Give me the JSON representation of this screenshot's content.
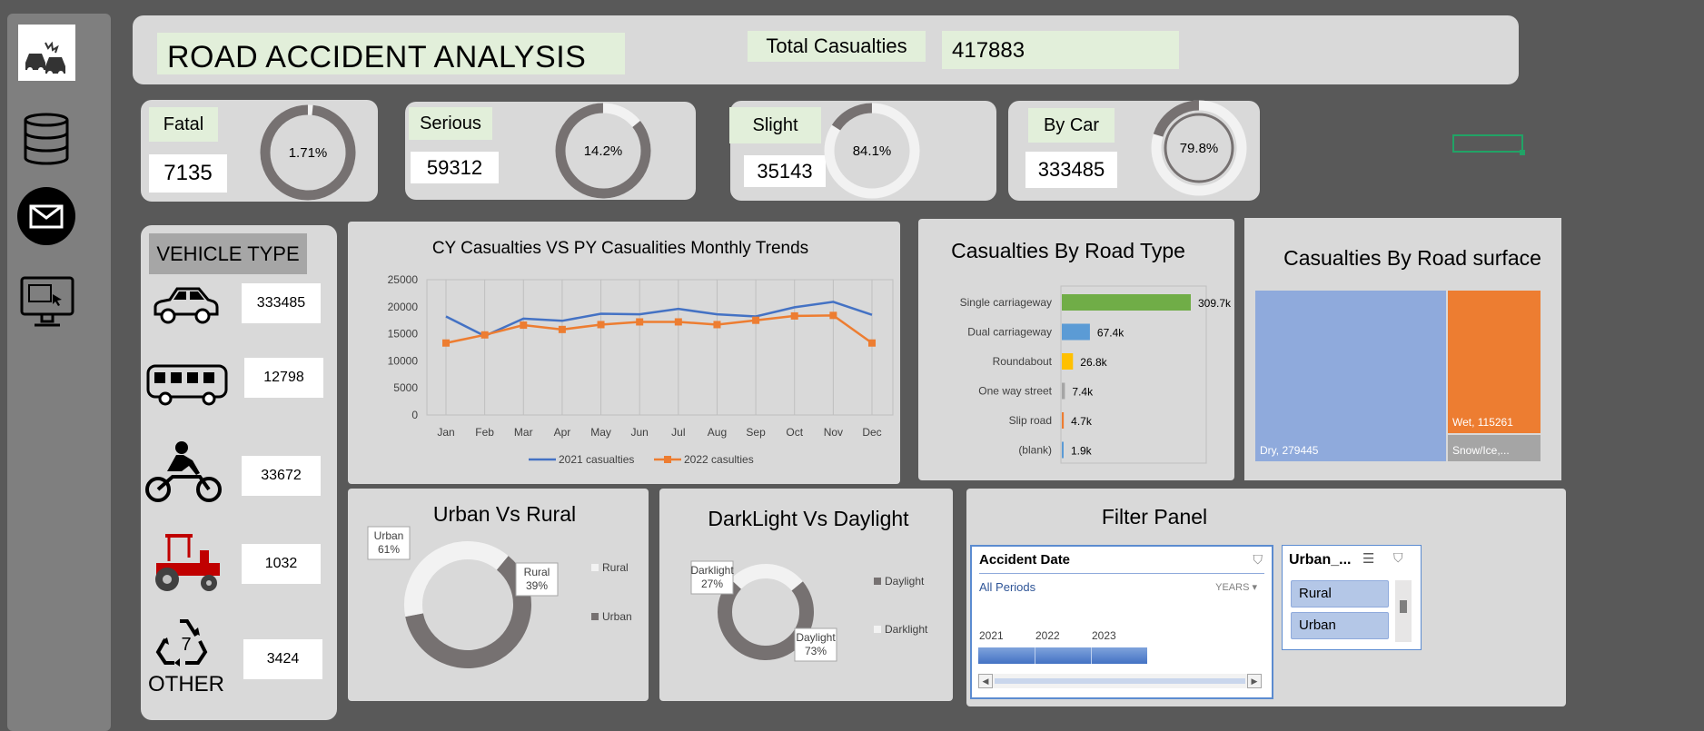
{
  "header": {
    "title": "ROAD ACCIDENT ANALYSIS",
    "total_label": "Total Casualties",
    "total_value": "417883"
  },
  "kpis": [
    {
      "label": "Fatal",
      "value": "7135",
      "pct_label": "1.71%",
      "pct": 1.71
    },
    {
      "label": "Serious",
      "value": "59312",
      "pct_label": "14.2%",
      "pct": 14.2
    },
    {
      "label": "Slight",
      "value": "35143",
      "pct_label": "84.1%",
      "pct": 84.1
    },
    {
      "label": "By Car",
      "value": "333485",
      "pct_label": "79.8%",
      "pct": 79.8
    }
  ],
  "vehicle": {
    "title": "VEHICLE TYPE",
    "items": [
      {
        "icon": "car-icon",
        "value": "333485"
      },
      {
        "icon": "bus-icon",
        "value": "12798"
      },
      {
        "icon": "motorbike-icon",
        "value": "33672"
      },
      {
        "icon": "tractor-icon",
        "value": "1032"
      },
      {
        "icon": "recycle-icon",
        "value": "3424",
        "label": "OTHER"
      }
    ]
  },
  "sidebar": {
    "icons": [
      "car-crash-icon",
      "database-icon",
      "mail-icon",
      "monitor-icon"
    ]
  },
  "colors": {
    "page_bg": "#595959",
    "panel": "#d9d9d9",
    "label_green": "#e2efda",
    "series_2021": "#4472c4",
    "series_2022": "#ed7d31",
    "donut_dark": "#767171",
    "donut_light": "#f2f2f2"
  },
  "chart_data": [
    {
      "type": "line",
      "title": "CY Casualties VS PY Casualities Monthly Trends",
      "categories": [
        "Jan",
        "Feb",
        "Mar",
        "Apr",
        "May",
        "Jun",
        "Jul",
        "Aug",
        "Sep",
        "Oct",
        "Nov",
        "Dec"
      ],
      "series": [
        {
          "name": "2021 casualties",
          "values": [
            18200,
            14600,
            17800,
            17400,
            18700,
            18600,
            19600,
            18600,
            18200,
            19900,
            20900,
            18500
          ]
        },
        {
          "name": "2022 casulties",
          "values": [
            13300,
            14800,
            16600,
            15800,
            16700,
            17200,
            17200,
            16700,
            17500,
            18300,
            18400,
            13300
          ]
        }
      ],
      "y_ticks": [
        "25000",
        "20000",
        "15000",
        "10000",
        "5000",
        "0"
      ],
      "ylim": [
        0,
        25000
      ],
      "grid": true,
      "legend": "bottom"
    },
    {
      "type": "bar",
      "title": "Casualties By Road Type",
      "categories": [
        "Single carriageway",
        "Dual carriageway",
        "Roundabout",
        "One way street",
        "Slip road",
        "(blank)"
      ],
      "values": [
        309.7,
        67.4,
        26.8,
        7.4,
        4.7,
        1.9
      ],
      "labels": [
        "309.7k",
        "67.4k",
        "26.8k",
        "7.4k",
        "4.7k",
        "1.9k"
      ],
      "colors": [
        "#70ad47",
        "#5b9bd5",
        "#ffc000",
        "#a5a5a5",
        "#ed7d31",
        "#5b9bd5"
      ],
      "orientation": "horizontal"
    },
    {
      "type": "treemap",
      "title": "Casualties By Road surface",
      "items": [
        {
          "label": "Dry, 279445",
          "value": 279445,
          "color": "#8faadc"
        },
        {
          "label": "Wet, 115261",
          "value": 115261,
          "color": "#ed7d31"
        },
        {
          "label": "Snow/Ice,...",
          "value": 23177,
          "color": "#a5a5a5"
        }
      ]
    },
    {
      "type": "pie",
      "title": "Urban Vs Rural",
      "slices": [
        {
          "name": "Urban",
          "label": "Urban\n61%",
          "value": 61,
          "color": "#767171"
        },
        {
          "name": "Rural",
          "label": "Rural\n39%",
          "value": 39,
          "color": "#f2f2f2"
        }
      ],
      "legend": [
        "Rural",
        "Urban"
      ]
    },
    {
      "type": "pie",
      "title": "DarkLight Vs Daylight",
      "slices": [
        {
          "name": "Daylight",
          "label": "Daylight\n73%",
          "value": 73,
          "color": "#767171"
        },
        {
          "name": "Darklight",
          "label": "Darklight\n27%",
          "value": 27,
          "color": "#f2f2f2"
        }
      ],
      "legend": [
        "Daylight",
        "Darklight"
      ]
    }
  ],
  "filter": {
    "title": "Filter Panel",
    "date_slicer": {
      "title": "Accident Date",
      "periods": "All Periods",
      "unit": "YEARS",
      "years": [
        "2021",
        "2022",
        "2023"
      ]
    },
    "urban_slicer": {
      "title": "Urban_...",
      "items": [
        "Rural",
        "Urban"
      ]
    }
  }
}
